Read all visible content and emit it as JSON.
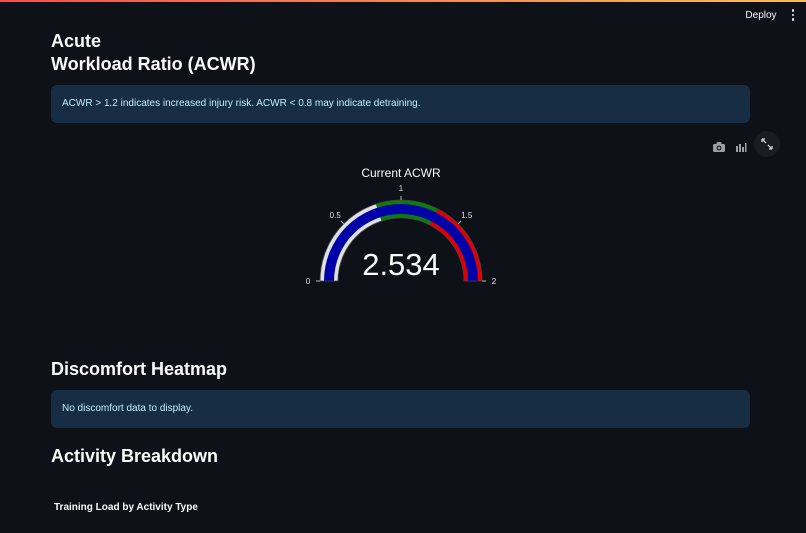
{
  "header": {
    "deploy_label": "Deploy",
    "menu_icon": "more-vertical-icon"
  },
  "acwr_section": {
    "title_line1": "Acute",
    "title_line2": "Workload Ratio (ACWR)",
    "info_text": "ACWR > 1.2 indicates increased injury risk. ACWR < 0.8 may indicate detraining."
  },
  "chart_toolbar": {
    "icons": [
      "camera-icon",
      "bar-chart-icon",
      "fullscreen-icon"
    ]
  },
  "chart_data": {
    "type": "gauge",
    "title": "Current ACWR",
    "value": 2.534,
    "value_label": "2.534",
    "range": [
      0,
      2
    ],
    "ticks": [
      "0",
      "0.5",
      "1",
      "1.5",
      "2"
    ],
    "tick_values": [
      0,
      0.5,
      1,
      1.5,
      2
    ],
    "steps": [
      {
        "range": [
          0,
          0.8
        ],
        "color": "#e0e0e0"
      },
      {
        "range": [
          0.8,
          1.3
        ],
        "color": "#0a7d0a"
      },
      {
        "range": [
          1.3,
          2
        ],
        "color": "#e00000"
      }
    ],
    "bar_color": "#0000a8"
  },
  "discomfort_section": {
    "title": "Discomfort Heatmap",
    "info_text": "No discomfort data to display."
  },
  "activity_section": {
    "title": "Activity Breakdown",
    "chart_title": "Training Load by Activity Type"
  }
}
